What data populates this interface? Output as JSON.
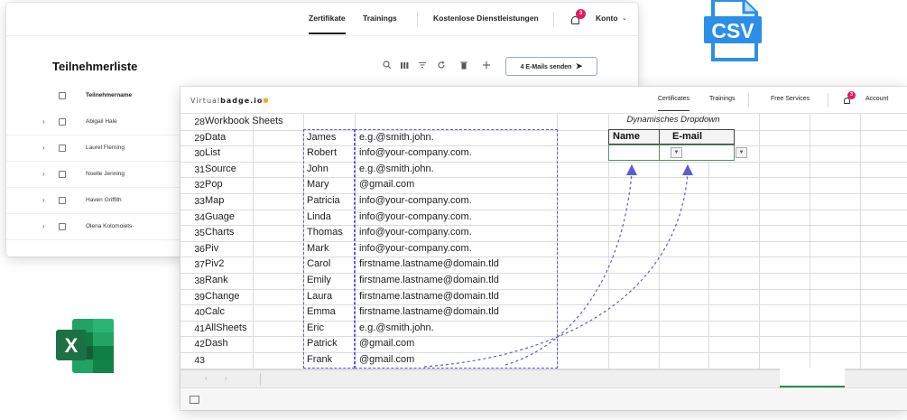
{
  "back_window": {
    "nav": {
      "tabs": [
        "Zertifikate",
        "Trainings",
        "Kostenlose Dienstleistungen"
      ],
      "active_tab": "Zertifikate",
      "notification_count": "3",
      "account_label": "Konto"
    },
    "page_title": "Teilnehmerliste",
    "toolbar_icons": [
      "search-icon",
      "columns-icon",
      "filter-icon",
      "refresh-icon",
      "trash-icon",
      "add-icon"
    ],
    "send_button_label": "4 E-Mails senden",
    "column_header": "Teilnehmername",
    "rows": [
      "Abigail Hale",
      "Laurel Fleming",
      "Noelle Jenning",
      "Haven Griffith",
      "Olena Kolomoiets"
    ]
  },
  "front_window": {
    "logo": {
      "prefix": "Virtual",
      "bold": "badge.io"
    },
    "nav": {
      "tabs": [
        "Certificates",
        "Trainings",
        "Free Services"
      ],
      "active_tab": "Certificates",
      "notification_count": "3",
      "account_label": "Account"
    },
    "sheet": {
      "rows": [
        {
          "num": "28",
          "a": "Workbook Sheets",
          "b": "",
          "c": ""
        },
        {
          "num": "29",
          "a": "Data",
          "b": "James",
          "c": " e.g.@smith.john."
        },
        {
          "num": "30",
          "a": "List",
          "b": "Robert",
          "c": "info@your-company.com."
        },
        {
          "num": "31",
          "a": "Source",
          "b": "John",
          "c": " e.g.@smith.john."
        },
        {
          "num": "32",
          "a": "Pop",
          "b": "Mary",
          "c": "@gmail.com"
        },
        {
          "num": "33",
          "a": "Map",
          "b": "Patricia",
          "c": "info@your-company.com."
        },
        {
          "num": "34",
          "a": "Guage",
          "b": "Linda",
          "c": "info@your-company.com."
        },
        {
          "num": "35",
          "a": "Charts",
          "b": "Thomas",
          "c": "info@your-company.com."
        },
        {
          "num": "36",
          "a": "Piv",
          "b": "Mark",
          "c": "info@your-company.com."
        },
        {
          "num": "37",
          "a": "Piv2",
          "b": "Carol",
          "c": "firstname.lastname@domain.tld"
        },
        {
          "num": "38",
          "a": "Rank",
          "b": "Emily",
          "c": "firstname.lastname@domain.tld"
        },
        {
          "num": "39",
          "a": "Change",
          "b": "Laura",
          "c": "firstname.lastname@domain.tld"
        },
        {
          "num": "40",
          "a": "Calc",
          "b": "Emma",
          "c": "firstname.lastname@domain.tld"
        },
        {
          "num": "41",
          "a": "AllSheets",
          "b": "Eric",
          "c": " e.g.@smith.john."
        },
        {
          "num": "42",
          "a": "Dash",
          "b": "Patrick",
          "c": "@gmail.com"
        },
        {
          "num": "43",
          "a": "",
          "b": "Frank",
          "c": "@gmail.com"
        }
      ],
      "dropdown": {
        "title": "Dynamisches Dropdown",
        "name_header": "Name",
        "email_header": "E-mail"
      }
    }
  },
  "icons": {
    "csv_label": "CSV",
    "excel_label": "X"
  },
  "colors": {
    "badge": "#e8185d",
    "dash_blue": "#5b5bdc",
    "csv_blue": "#2b8fe8",
    "excel_green": "#1d7044"
  }
}
